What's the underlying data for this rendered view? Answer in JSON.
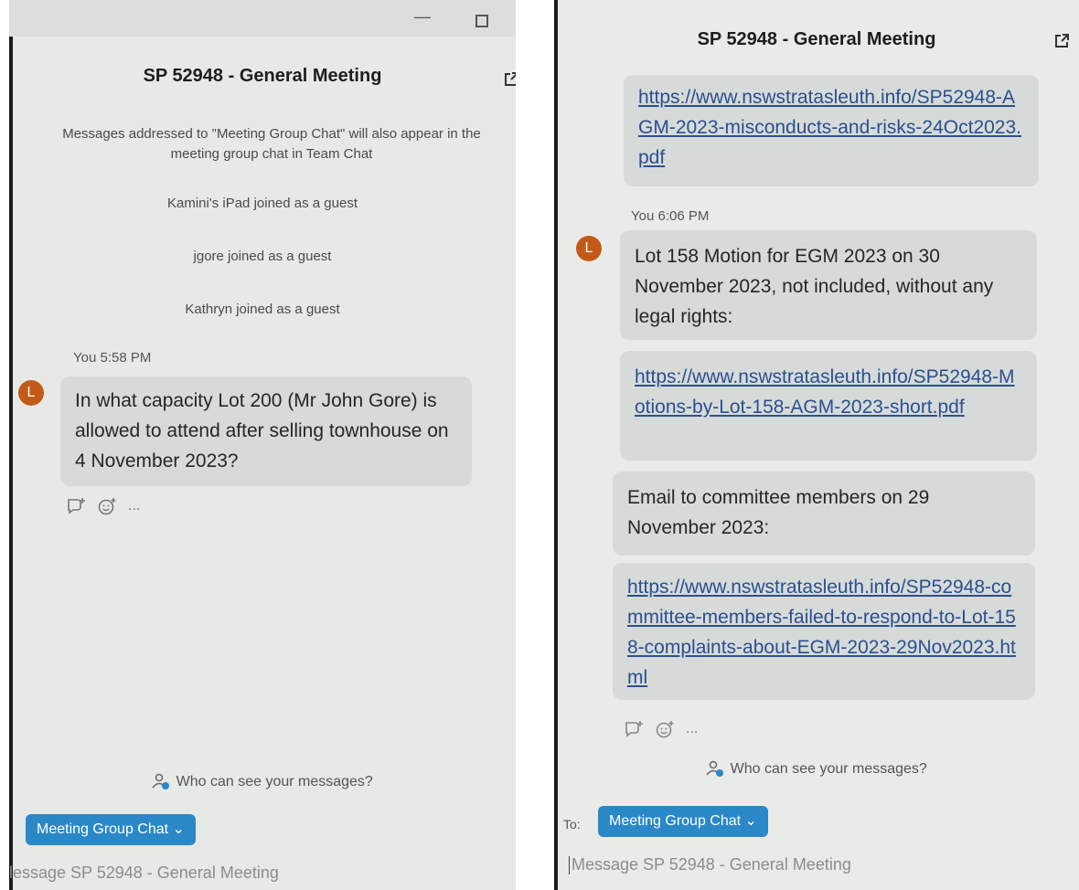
{
  "left": {
    "title": "SP 52948 - General Meeting",
    "system_messages": [
      "Messages addressed to \"Meeting Group Chat\" will also appear in the meeting group chat in Team Chat",
      "Kamini's iPad joined as a guest",
      "jgore joined as a guest",
      "Kathryn joined as a guest"
    ],
    "message": {
      "sender": "You 5:58 PM",
      "avatar": "L",
      "text": "In what capacity Lot 200 (Mr John Gore) is allowed to attend after selling townhouse on 4 November 2023?"
    },
    "actions": {
      "icons": [
        "reply-icon",
        "emoji-icon",
        "more-icon"
      ],
      "more_label": "..."
    },
    "who_can_see": "Who can see your messages?",
    "recipient_button": "Meeting Group Chat",
    "composer_placeholder": "lessage SP 52948 - General Meeting"
  },
  "right": {
    "title": "SP 52948 - General Meeting",
    "top_link": "https://www.nswstratasleuth.info/SP52948-AGM-2023-misconducts-and-risks-24Oct2023.pdf",
    "message": {
      "sender": "You 6:06 PM",
      "avatar": "L",
      "text": "Lot 158 Motion for EGM 2023 on 30 November 2023, not included, without any legal rights:"
    },
    "link2": "https://www.nswstratasleuth.info/SP52948-Motions-by-Lot-158-AGM-2023-short.pdf",
    "email_text": "Email to committee members on 29 November 2023:",
    "link3": "https://www.nswstratasleuth.info/SP52948-committee-members-failed-to-respond-to-Lot-158-complaints-about-EGM-2023-29Nov2023.html",
    "actions": {
      "icons": [
        "reply-icon",
        "emoji-icon",
        "more-icon"
      ],
      "more_label": "..."
    },
    "who_can_see": "Who can see your messages?",
    "to_label": "To:",
    "recipient_button": "Meeting Group Chat",
    "composer_placeholder": "Message SP 52948 - General Meeting"
  },
  "colors": {
    "accent": "#2a88c7",
    "avatar": "#c25a17",
    "bubble": "#d6dbda",
    "link": "#2c4f8f"
  }
}
